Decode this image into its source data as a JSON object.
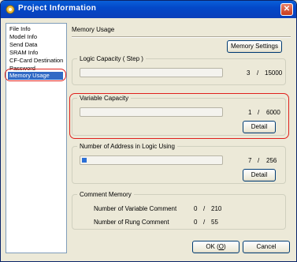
{
  "window": {
    "title": "Project Information"
  },
  "sidebar": {
    "items": [
      {
        "label": "File Info"
      },
      {
        "label": "Model Info"
      },
      {
        "label": "Send Data"
      },
      {
        "label": "SRAM Info"
      },
      {
        "label": "CF-Card Destination"
      },
      {
        "label": "Password"
      },
      {
        "label": "Memory Usage",
        "selected": true
      }
    ]
  },
  "main": {
    "header": "Memory Usage",
    "memory_settings_label": "Memory Settings",
    "logic": {
      "label": "Logic Capacity ( Step )",
      "used": "3",
      "separator": "/",
      "total": "15000",
      "fraction": 0.0002
    },
    "variable": {
      "label": "Variable Capacity",
      "used": "1",
      "separator": "/",
      "total": "6000",
      "fraction": 0.0002,
      "detail_label": "Detail"
    },
    "address": {
      "label": "Number of Address in Logic Using",
      "used": "7",
      "separator": "/",
      "total": "256",
      "fraction": 0.027,
      "detail_label": "Detail"
    },
    "comment": {
      "label": "Comment Memory",
      "rows": [
        {
          "label": "Number of Variable Comment",
          "used": "0",
          "separator": "/",
          "total": "210"
        },
        {
          "label": "Number of Rung Comment",
          "used": "0",
          "separator": "/",
          "total": "55"
        }
      ]
    }
  },
  "footer": {
    "ok_label": "OK (",
    "ok_mnemonic": "O",
    "ok_suffix": ")",
    "cancel_label": "Cancel"
  },
  "colors": {
    "accent": "#316ac5",
    "highlight_ring": "#e0201c",
    "title_bar": "#0348c8"
  }
}
